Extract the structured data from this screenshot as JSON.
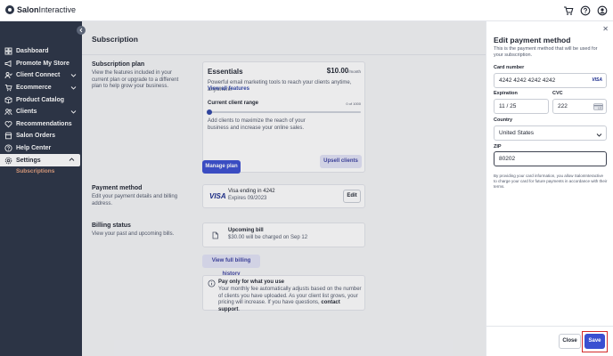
{
  "app": {
    "logo_bold": "Salon",
    "logo_rest": "Interactive"
  },
  "sidebar": {
    "items": [
      {
        "label": "Dashboard",
        "icon": "grid-icon",
        "chevron": false
      },
      {
        "label": "Promote My Store",
        "icon": "megaphone-icon",
        "chevron": false
      },
      {
        "label": "Client Connect",
        "icon": "user-check-icon",
        "chevron": true
      },
      {
        "label": "Ecommerce",
        "icon": "cart-icon",
        "chevron": true
      },
      {
        "label": "Product Catalog",
        "icon": "box-icon",
        "chevron": false
      },
      {
        "label": "Clients",
        "icon": "users-icon",
        "chevron": true
      },
      {
        "label": "Recommendations",
        "icon": "heart-icon",
        "chevron": false
      },
      {
        "label": "Salon Orders",
        "icon": "store-icon",
        "chevron": false
      },
      {
        "label": "Help Center",
        "icon": "help-icon",
        "chevron": false
      },
      {
        "label": "Settings",
        "icon": "gear-icon",
        "chevron": true
      }
    ],
    "sub_item": "Subscriptions"
  },
  "main": {
    "title": "Subscription",
    "plan_section": {
      "title": "Subscription plan",
      "desc": "View the features included in your current plan or upgrade to a different plan to help grow your business."
    },
    "plan_card": {
      "name": "Essentials",
      "price": "$10.00",
      "price_unit": "/month",
      "desc": "Powerful email marketing tools to reach your clients anytime, anywhere.",
      "features_link": "View all features",
      "range_label": "Current client range",
      "range_value": "0 of 1000",
      "range_fraction": 0.0,
      "range_desc": "Add clients to maximize the reach of your business and increase your online sales.",
      "upgrade_btn": "Upsell clients"
    },
    "manage_btn": "Manage plan",
    "payment_section": {
      "title": "Payment method",
      "desc": "Edit your payment details and billing address."
    },
    "payment_card": {
      "brand": "VISA",
      "line1": "Visa ending in 4242",
      "line2": "Expires 09/2023",
      "edit_btn": "Edit"
    },
    "billing_section": {
      "title": "Billing status",
      "desc": "View your past and upcoming bills."
    },
    "bill_card": {
      "title": "Upcoming bill",
      "desc": "$30.00 will be charged on Sep 12"
    },
    "history_btn": "View full billing history",
    "info_card": {
      "title": "Pay only for what you use",
      "body_start": "Your monthly fee automatically adjusts based on the number of clients you have uploaded. As your client list grows, your pricing will increase. If you have questions, ",
      "link": "contact support",
      "body_end": "."
    }
  },
  "panel": {
    "title": "Edit payment method",
    "subtitle": "This is the payment method that will be used for your subscription.",
    "card_number_label": "Card number",
    "card_number": "4242 4242 4242 4242",
    "card_brand": "VISA",
    "expiration_label": "Expiration",
    "expiration": "11 / 25",
    "cvc_label": "CVC",
    "cvc": "222",
    "country_label": "Country",
    "country": "United States",
    "zip_label": "ZIP",
    "zip": "80202",
    "terms": "By providing your card information, you allow SalonInteractive to charge your card for future payments in accordance with their terms.",
    "close_btn": "Close",
    "save_btn": "Save"
  }
}
